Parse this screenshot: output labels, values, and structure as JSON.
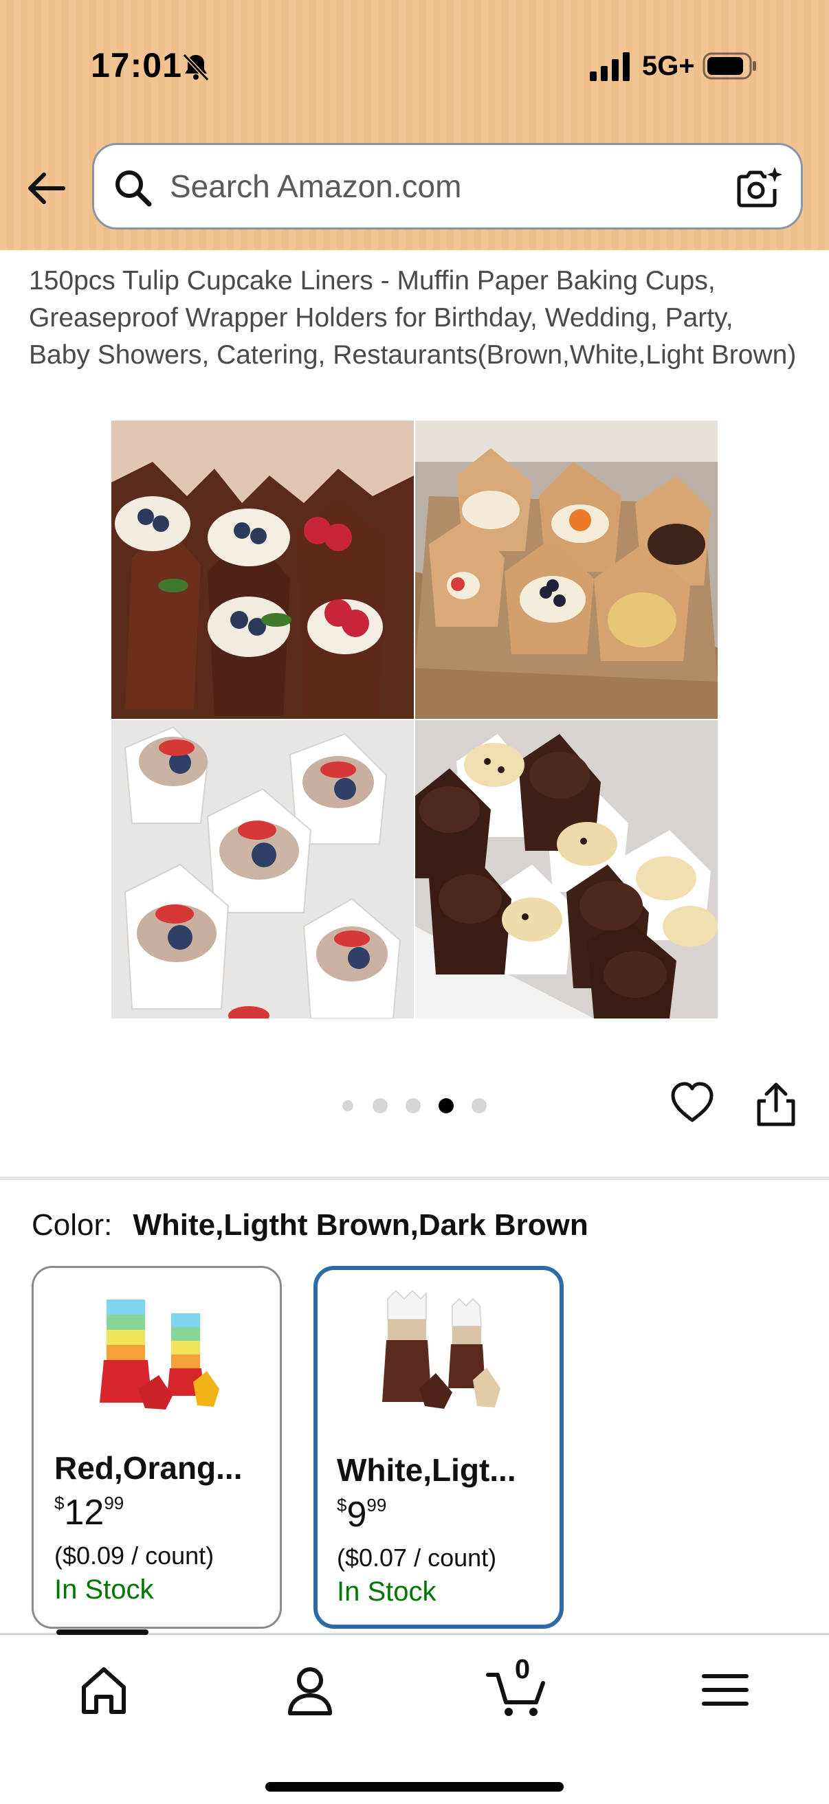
{
  "status_bar": {
    "time": "17:01",
    "network": "5G+"
  },
  "search": {
    "placeholder": "Search Amazon.com"
  },
  "product": {
    "title": "150pcs Tulip Cupcake Liners - Muffin Paper Baking Cups, Greaseproof Wrapper Holders for Birthday, Wedding, Party, Baby Showers, Catering, Restaurants(Brown,White,Light Brown)"
  },
  "gallery": {
    "dot_count": 5,
    "active_dot": 3
  },
  "color": {
    "label": "Color:",
    "selected": "White,Ligtht Brown,Dark Brown"
  },
  "variants": [
    {
      "name": "Red,Orang...",
      "price_symbol": "$",
      "price_whole": "12",
      "price_fraction": "99",
      "unit_price": "($0.09 / count)",
      "stock": "In Stock",
      "selected": false
    },
    {
      "name": "White,Ligt...",
      "price_symbol": "$",
      "price_whole": "9",
      "price_fraction": "99",
      "unit_price": "($0.07 / count)",
      "stock": "In Stock",
      "selected": true
    }
  ],
  "nav": {
    "cart_count": "0"
  },
  "colors": {
    "accent_selected": "#2d6aa8",
    "in_stock": "#007600",
    "header_bg": "#f2c694"
  }
}
